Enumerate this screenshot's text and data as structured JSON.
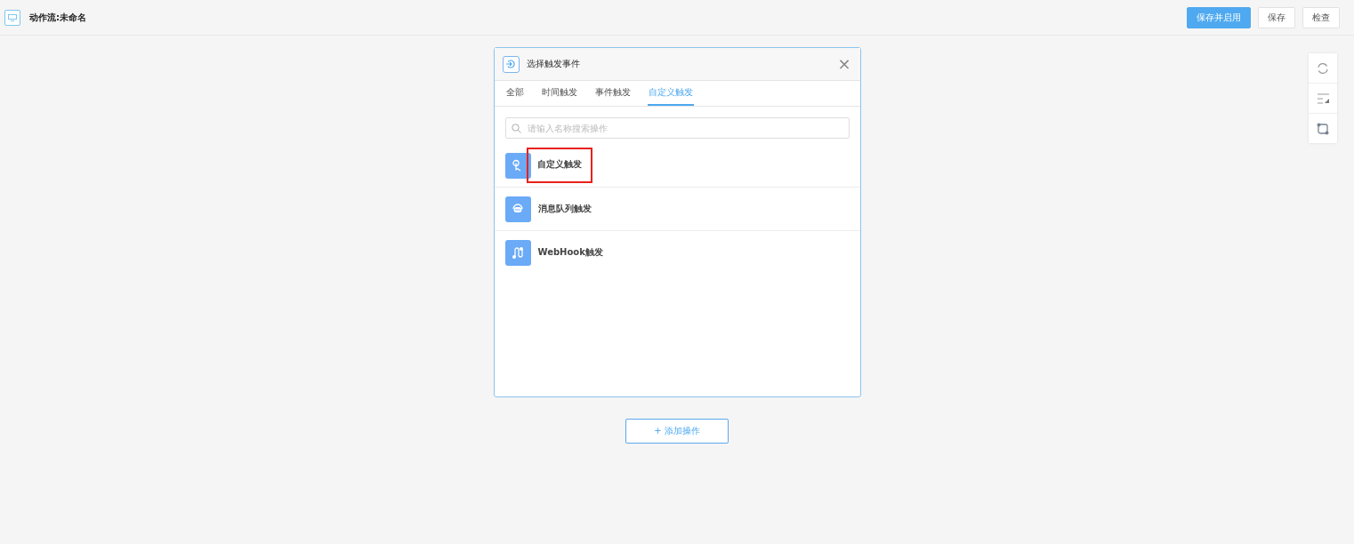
{
  "header": {
    "title": "动作流:未命名",
    "buttons": [
      {
        "label": "保存并启用",
        "kind": "primary"
      },
      {
        "label": "保存",
        "kind": "default"
      },
      {
        "label": "检查",
        "kind": "default"
      }
    ]
  },
  "dialog": {
    "title": "选择触发事件",
    "close": "×",
    "tabs": [
      {
        "label": "全部",
        "selected": false
      },
      {
        "label": "时间触发",
        "selected": false
      },
      {
        "label": "事件触发",
        "selected": false
      },
      {
        "label": "自定义触发",
        "selected": true
      }
    ],
    "search": {
      "placeholder": "请输入名称搜索操作"
    },
    "items": [
      {
        "label": "自定义触发",
        "kind": "custom",
        "highlighted": true
      },
      {
        "label": "消息队列触发",
        "kind": "queue",
        "highlighted": false
      },
      {
        "label": "WebHook触发",
        "kind": "webhook",
        "highlighted": false
      }
    ]
  },
  "add_button": "+ 添加操作"
}
